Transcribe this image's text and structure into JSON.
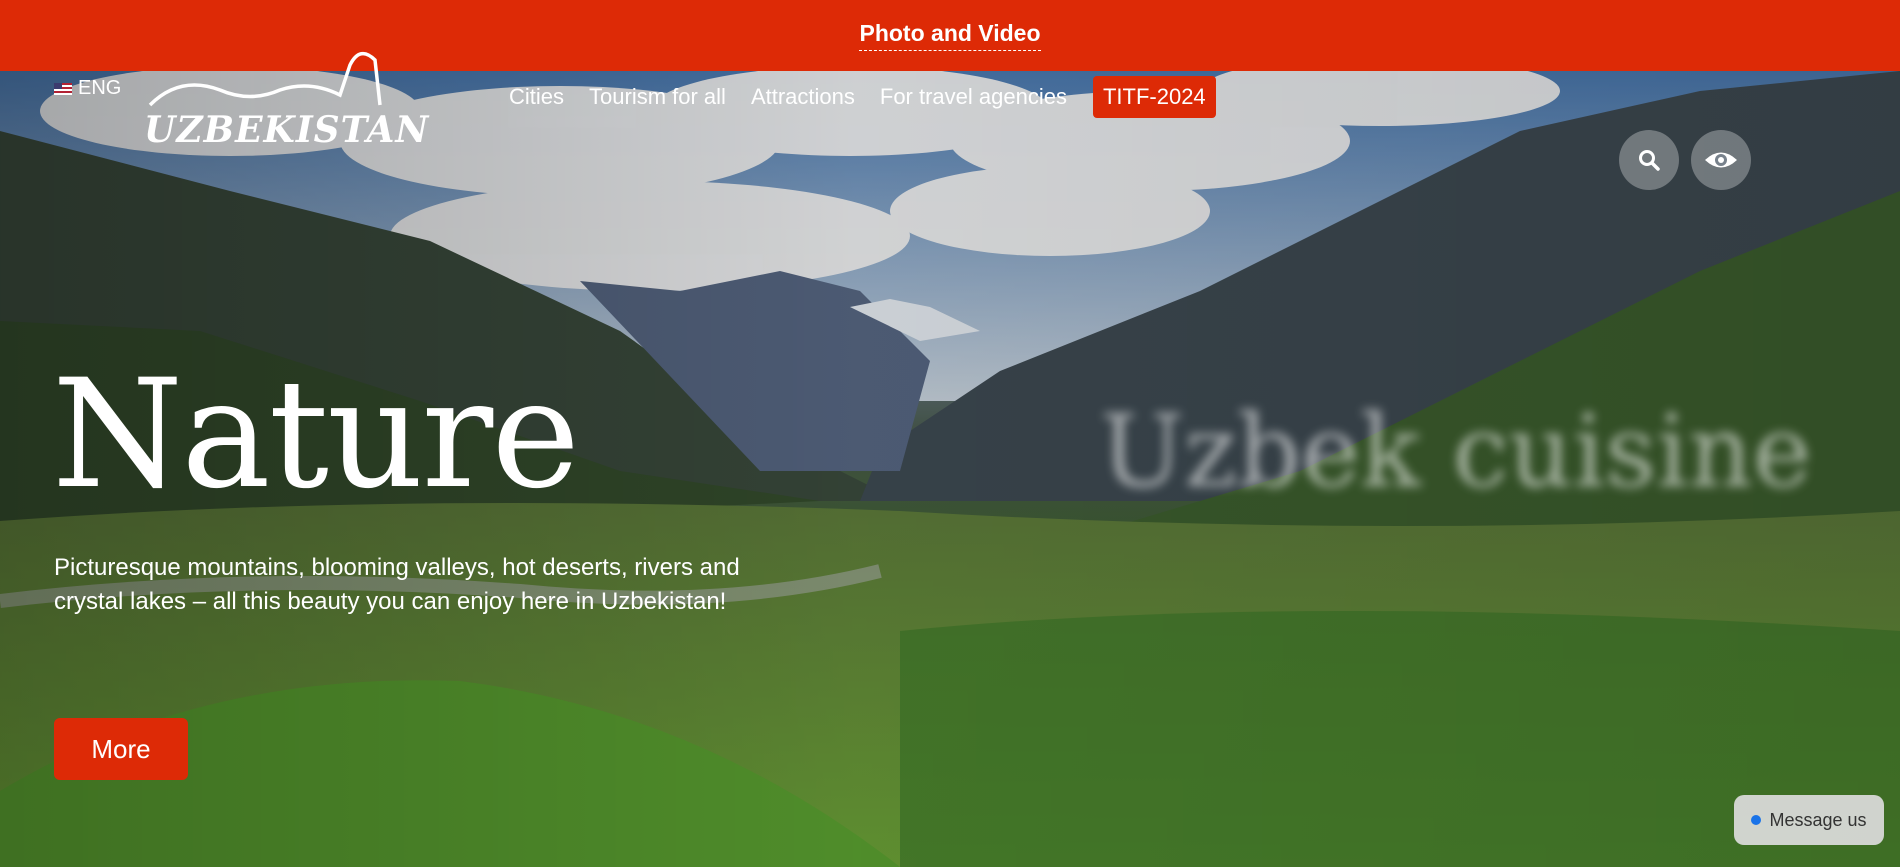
{
  "topbar": {
    "link": "Photo and Video"
  },
  "header": {
    "language": "ENG",
    "logo_text": "UZBEKISTAN",
    "nav": [
      {
        "label": "Cities"
      },
      {
        "label": "Tourism for all"
      },
      {
        "label": "Attractions"
      },
      {
        "label": "For travel agencies"
      },
      {
        "label": "TITF-2024"
      }
    ],
    "icons": [
      "search-icon",
      "eye-icon"
    ]
  },
  "hero": {
    "title": "Nature",
    "next_slide_title": "Uzbek cuisine",
    "description": "Picturesque mountains, blooming valleys, hot deserts, rivers and crystal lakes – all this beauty you can enjoy here in Uzbekistan!",
    "more_button": "More"
  },
  "chat": {
    "label": "Message us"
  },
  "colors": {
    "accent": "#dd2a06",
    "text": "#ffffff"
  }
}
